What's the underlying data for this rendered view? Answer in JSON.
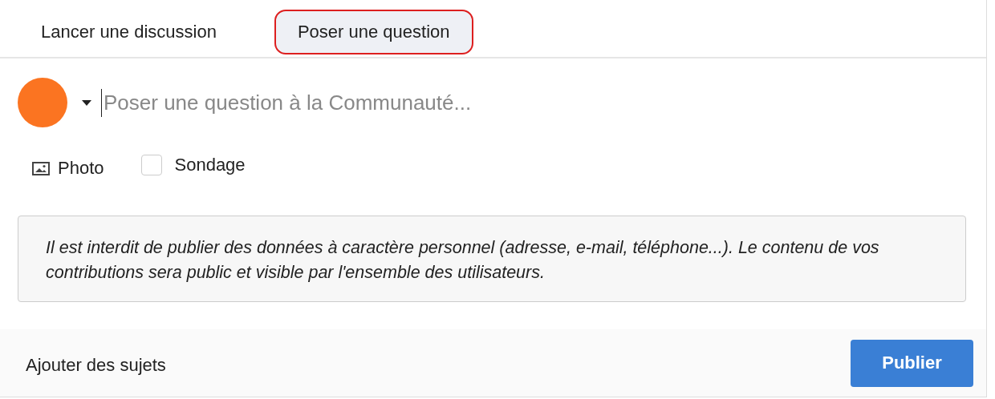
{
  "tabs": [
    {
      "label": "Lancer une discussion",
      "selected": false
    },
    {
      "label": "Poser une question",
      "selected": true
    }
  ],
  "composer": {
    "placeholder": "Poser une question à la Communauté..."
  },
  "attachments": {
    "photo": "Photo",
    "poll": {
      "label": "Sondage",
      "checked": false
    }
  },
  "notice": "Il est interdit de publier des données à caractère personnel (adresse, e-mail, téléphone...).  Le contenu de vos contributions sera public et visible par l'ensemble des utilisateurs.",
  "footer": {
    "topics": "Ajouter des sujets",
    "publish": "Publier"
  }
}
